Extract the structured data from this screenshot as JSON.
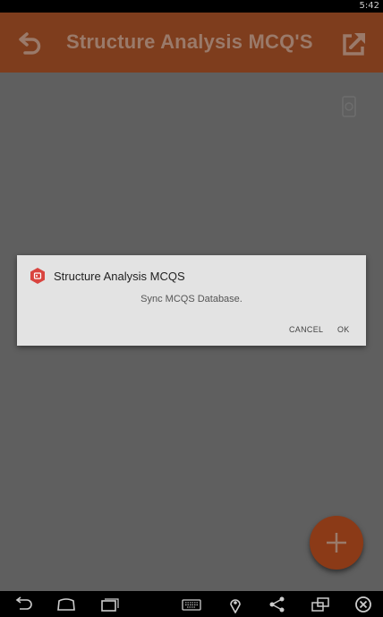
{
  "status_bar": {
    "time": "5:42"
  },
  "app_bar": {
    "title": "Structure Analysis MCQ'S",
    "back_icon": "back-arrow-icon",
    "share_icon": "open-external-icon",
    "color": "#7e3d1d"
  },
  "dialog": {
    "title": "Structure Analysis MCQS",
    "message": "Sync MCQS Database.",
    "cancel_label": "CANCEL",
    "ok_label": "OK",
    "icon": "app-icon",
    "icon_color": "#d9443f"
  },
  "fab": {
    "icon": "plus-icon",
    "color": "#8b3a17"
  },
  "nav_bar": {
    "icons": [
      "back-icon",
      "home-icon",
      "recent-apps-icon",
      "keyboard-icon",
      "location-icon",
      "share-icon",
      "screen-rotate-icon",
      "close-icon"
    ]
  }
}
